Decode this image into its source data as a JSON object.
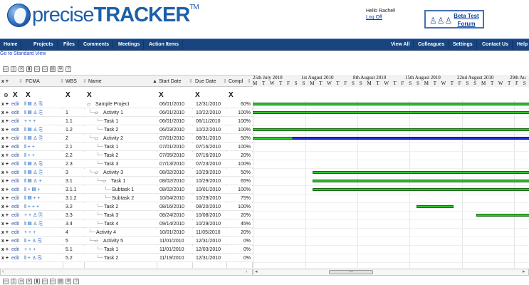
{
  "header": {
    "logo_text": "precise",
    "logo_text_bold": "TRACKER",
    "logo_tm": "TM",
    "greeting": "Hello Rachel!",
    "logoff": "Log Off",
    "beta_line1": "Beta Test",
    "beta_line2": "Forum"
  },
  "nav": {
    "left": [
      "Home",
      "Projects",
      "Files",
      "Comments",
      "Meetings",
      "Action Items"
    ],
    "right": [
      "View All",
      "Colleagues",
      "Settings",
      "Contact Us",
      "Help"
    ]
  },
  "std_view_link": "Go to Standard View",
  "toolbar_icons": [
    "print-icon",
    "copy-icon",
    "cut-icon",
    "delete-icon",
    "folder-icon",
    "open-folder-icon",
    "export-icon",
    "settings-icon",
    "help-icon"
  ],
  "bottom_toolbar_icons": [
    "print-icon",
    "copy-icon",
    "link-icon",
    "cut-icon",
    "delete-icon",
    "folder-icon",
    "open-folder-icon",
    "export-icon",
    "settings-icon",
    "help-icon"
  ],
  "columns": {
    "ctl": "x +",
    "fcma": "FCMA",
    "wbs": "WBS",
    "name": "Name",
    "start": "Start Date",
    "due": "Due Date",
    "compl": "Compl"
  },
  "filter_marks": [
    "X",
    "X",
    "X",
    "X",
    "X",
    "X",
    "X"
  ],
  "gantt": {
    "weeks": [
      "25th July 2010",
      "1st August 2010",
      "8th August 2010",
      "15th August 2010",
      "22nd August 2010",
      "29th Au"
    ],
    "days": "M T W T F S S M T W T F S S M T W T F S S M T W T F S S M T W T F S S M T"
  },
  "rows": [
    {
      "ctl": "x +",
      "edit": "edit",
      "icons": "⫴ ▤ ♙ ⎘",
      "wbs": "",
      "name": "Sample Project",
      "indent": 1,
      "kind": "folder",
      "start": "06/01/2010",
      "due": "12/31/2010",
      "compl": "60%"
    },
    {
      "ctl": "x +",
      "edit": "edit",
      "icons": "⫴ ▤ ♙ ⎘",
      "wbs": "1",
      "name": "Activity 1",
      "indent": 2,
      "kind": "folder",
      "start": "06/01/2010",
      "due": "10/22/2010",
      "compl": "100%"
    },
    {
      "ctl": "x +",
      "edit": "edit",
      "icons": "+ + +",
      "wbs": "1.1",
      "name": "Task 1",
      "indent": 3,
      "kind": "task",
      "start": "06/01/2010",
      "due": "06/11/2010",
      "compl": "100%"
    },
    {
      "ctl": "x +",
      "edit": "edit",
      "icons": "⫴ ▤ ♙ ⎘",
      "wbs": "1.2",
      "name": "Task 2",
      "indent": 3,
      "kind": "task",
      "start": "06/03/2010",
      "due": "10/22/2010",
      "compl": "100%"
    },
    {
      "ctl": "x +",
      "edit": "edit",
      "icons": "⫴ ▤ ♙ ⎘",
      "wbs": "2",
      "name": "Activity 2",
      "indent": 2,
      "kind": "folder",
      "start": "07/01/2010",
      "due": "08/31/2010",
      "compl": "50%"
    },
    {
      "ctl": "x +",
      "edit": "edit",
      "icons": "⫴ + +",
      "wbs": "2.1",
      "name": "Task 1",
      "indent": 3,
      "kind": "task",
      "start": "07/01/2010",
      "due": "07/16/2010",
      "compl": "100%"
    },
    {
      "ctl": "x +",
      "edit": "edit",
      "icons": "⫴ + +",
      "wbs": "2.2",
      "name": "Task 2",
      "indent": 3,
      "kind": "task",
      "start": "07/05/2010",
      "due": "07/16/2010",
      "compl": "20%"
    },
    {
      "ctl": "x +",
      "edit": "edit",
      "icons": "⫴ ▤ ♙ ⎘",
      "wbs": "2.3",
      "name": "Task 3",
      "indent": 3,
      "kind": "task",
      "start": "07/13/2010",
      "due": "07/23/2010",
      "compl": "100%"
    },
    {
      "ctl": "x +",
      "edit": "edit",
      "icons": "⫴ ▤ ♙ ⎘",
      "wbs": "3",
      "name": "Activity 3",
      "indent": 2,
      "kind": "folder",
      "start": "08/02/2010",
      "due": "10/29/2010",
      "compl": "50%"
    },
    {
      "ctl": "x +",
      "edit": "edit",
      "icons": "⫴ ▤ ♙ +",
      "wbs": "3.1",
      "name": "Task 1",
      "indent": 3,
      "kind": "folder",
      "start": "08/02/2010",
      "due": "10/29/2010",
      "compl": "65%"
    },
    {
      "ctl": "x +",
      "edit": "edit",
      "icons": "⫴ + ▤ +",
      "wbs": "3.1.1",
      "name": "Subtask 1",
      "indent": 4,
      "kind": "task",
      "start": "08/02/2010",
      "due": "10/01/2010",
      "compl": "100%"
    },
    {
      "ctl": "x +",
      "edit": "edit",
      "icons": "⫴ ▤ + +",
      "wbs": "3.1.2",
      "name": "Subtask 2",
      "indent": 4,
      "kind": "task",
      "start": "10/04/2010",
      "due": "10/29/2010",
      "compl": "75%"
    },
    {
      "ctl": "x +",
      "edit": "edit",
      "icons": "⫴ + + +",
      "wbs": "3.2",
      "name": "Task 2",
      "indent": 3,
      "kind": "task",
      "start": "08/16/2010",
      "due": "08/20/2010",
      "compl": "100%"
    },
    {
      "ctl": "x +",
      "edit": "edit",
      "icons": "+ + ♙ ⎘",
      "wbs": "3.3",
      "name": "Task 3",
      "indent": 3,
      "kind": "task",
      "start": "08/24/2010",
      "due": "10/08/2010",
      "compl": "20%"
    },
    {
      "ctl": "x +",
      "edit": "edit",
      "icons": "⫴ ▤ ♙ ⎘",
      "wbs": "3.4",
      "name": "Task 4",
      "indent": 3,
      "kind": "task",
      "start": "09/14/2010",
      "due": "10/29/2010",
      "compl": "45%"
    },
    {
      "ctl": "x +",
      "edit": "edit",
      "icons": "+ + +",
      "wbs": "4",
      "name": "Activity 4",
      "indent": 2,
      "kind": "task",
      "start": "10/01/2010",
      "due": "11/05/2010",
      "compl": "20%"
    },
    {
      "ctl": "x +",
      "edit": "edit",
      "icons": "⫴ + ♙ ⎘",
      "wbs": "5",
      "name": "Activity 5",
      "indent": 2,
      "kind": "folder",
      "start": "11/01/2010",
      "due": "12/31/2010",
      "compl": "0%"
    },
    {
      "ctl": "x +",
      "edit": "edit",
      "icons": "+ + +",
      "wbs": "5.1",
      "name": "Task 1",
      "indent": 3,
      "kind": "task",
      "start": "11/01/2010",
      "due": "12/03/2010",
      "compl": "0%"
    },
    {
      "ctl": "x +",
      "edit": "edit",
      "icons": "⫴ + ♙ ⎘",
      "wbs": "5.2",
      "name": "Task 2",
      "indent": 3,
      "kind": "task",
      "start": "11/19/2010",
      "due": "12/31/2010",
      "compl": "0%"
    }
  ],
  "gantt_bars": [
    {
      "row": 0,
      "start": "06/01/2010",
      "end": "12/31/2010",
      "color": "#2fc22c"
    },
    {
      "row": 1,
      "start": "06/01/2010",
      "end": "10/22/2010",
      "color": "#2fc22c"
    },
    {
      "row": 3,
      "start": "06/03/2010",
      "end": "10/22/2010",
      "color": "#2fc22c"
    },
    {
      "row": 4,
      "start": "07/01/2010",
      "end": "08/31/2010",
      "color": "#1c2fd0",
      "head": "#2fc22c"
    },
    {
      "row": 8,
      "start": "08/02/2010",
      "end": "10/29/2010",
      "color": "#2fc22c"
    },
    {
      "row": 9,
      "start": "08/02/2010",
      "end": "10/29/2010",
      "color": "#2fc22c"
    },
    {
      "row": 10,
      "start": "08/02/2010",
      "end": "10/01/2010",
      "color": "#2fc22c"
    },
    {
      "row": 12,
      "start": "08/16/2010",
      "end": "08/20/2010",
      "color": "#2fc22c"
    },
    {
      "row": 13,
      "start": "08/24/2010",
      "end": "10/08/2010",
      "color": "#2fc22c"
    }
  ]
}
